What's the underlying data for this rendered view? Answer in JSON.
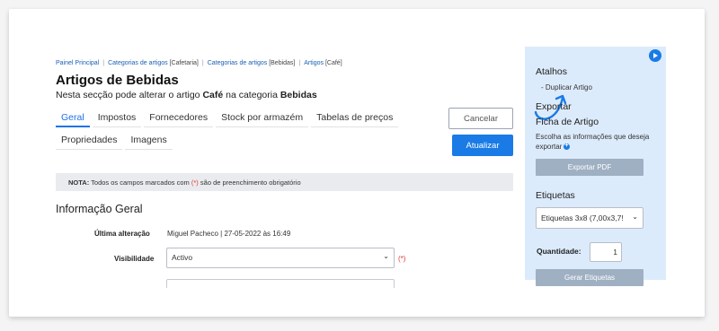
{
  "breadcrumb": {
    "items": [
      {
        "label": "Painel Principal",
        "suffix": ""
      },
      {
        "label": "Categorias de artigos",
        "suffix": " [Cafetaria]"
      },
      {
        "label": "Categorias de artigos",
        "suffix": " [Bebidas]"
      },
      {
        "label": "Artigos",
        "suffix": " [Café]"
      }
    ]
  },
  "header": {
    "title": "Artigos de Bebidas",
    "subtitle_prefix": "Nesta secção pode alterar o artigo",
    "subtitle_item": "Café",
    "subtitle_mid": "na categoria",
    "subtitle_category": "Bebidas"
  },
  "tabs": {
    "row1": [
      "Geral",
      "Impostos",
      "Fornecedores",
      "Stock por armazém",
      "Tabelas de preços"
    ],
    "row2": [
      "Propriedades",
      "Imagens"
    ],
    "active": "Geral"
  },
  "actions": {
    "cancel_label": "Cancelar",
    "update_label": "Atualizar"
  },
  "note": {
    "label": "NOTA:",
    "text_before": "Todos os campos marcados com",
    "required_marker": "(*)",
    "text_after": "são de preenchimento obrigatório"
  },
  "general_info": {
    "section_title": "Informação Geral",
    "last_change_label": "Última alteração",
    "last_change_value": "Miguel Pacheco | 27-05-2022 às 16:49",
    "visibility_label": "Visibilidade",
    "visibility_value": "Activo",
    "visibility_required": "(*)"
  },
  "sidebar": {
    "shortcuts_title": "Atalhos",
    "shortcut_link": "- Duplicar Artigo",
    "export_title": "Exportar",
    "sheet_title": "Ficha de Artigo",
    "sheet_text": "Escolha as informações que deseja exportar",
    "export_pdf_label": "Exportar PDF",
    "labels_title": "Etiquetas",
    "labels_select_value": "Etiquetas 3x8 (7,00x3,7!",
    "quantity_label": "Quantidade:",
    "quantity_value": "1",
    "generate_label": "Gerar Etiquetas"
  },
  "colors": {
    "accent": "#1a7be6",
    "sidebar_bg": "#dcebfb",
    "required": "#e53935",
    "disabled_button": "#9fb0c3"
  },
  "icons": [
    "play-icon",
    "chevron-down-icon",
    "info-plus-icon",
    "hand-drawn-arrow"
  ]
}
